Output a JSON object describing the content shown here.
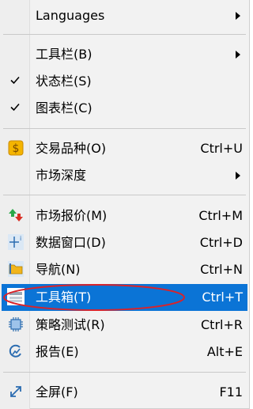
{
  "menu": {
    "items": [
      {
        "label": "Languages",
        "shortcut": "",
        "submenu": true,
        "icon": ""
      },
      {
        "label": "工具栏(B)",
        "shortcut": "",
        "submenu": true,
        "icon": ""
      },
      {
        "label": "状态栏(S)",
        "shortcut": "",
        "checked": true,
        "icon": "check-icon"
      },
      {
        "label": "图表栏(C)",
        "shortcut": "",
        "checked": true,
        "icon": "check-icon"
      },
      {
        "label": "交易品种(O)",
        "shortcut": "Ctrl+U",
        "icon": "dollar-icon"
      },
      {
        "label": "市场深度",
        "shortcut": "",
        "submenu": true,
        "icon": ""
      },
      {
        "label": "市场报价(M)",
        "shortcut": "Ctrl+M",
        "icon": "quotes-arrows-icon"
      },
      {
        "label": "数据窗口(D)",
        "shortcut": "Ctrl+D",
        "icon": "crosshair-icon"
      },
      {
        "label": "导航(N)",
        "shortcut": "Ctrl+N",
        "icon": "folder-icon"
      },
      {
        "label": "工具箱(T)",
        "shortcut": "Ctrl+T",
        "icon": "toolbox-icon",
        "selected": true
      },
      {
        "label": "策略测试(R)",
        "shortcut": "Ctrl+R",
        "icon": "chip-icon"
      },
      {
        "label": "报告(E)",
        "shortcut": "Alt+E",
        "icon": "report-icon"
      },
      {
        "label": "全屏(F)",
        "shortcut": "F11",
        "icon": "fullscreen-icon"
      }
    ]
  },
  "colors": {
    "selection": "#0b74d6",
    "annotation": "#d9232a"
  }
}
